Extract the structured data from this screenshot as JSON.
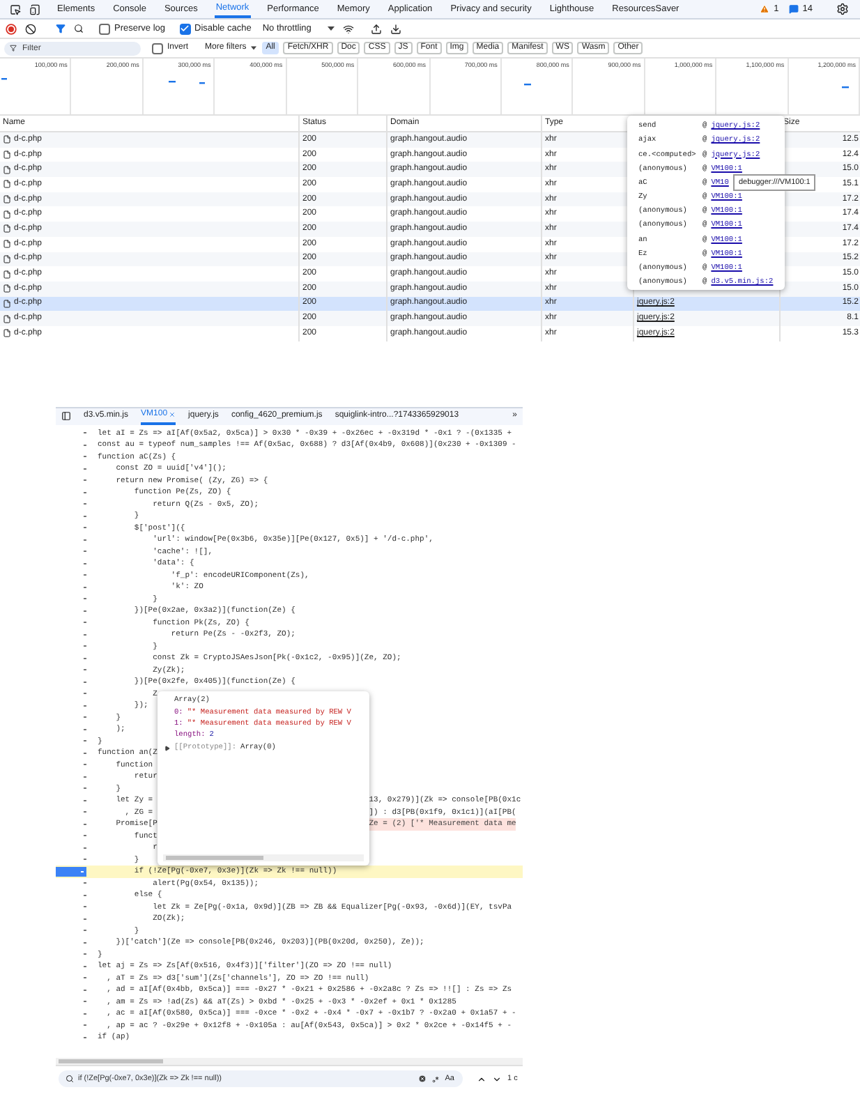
{
  "devtools_tabs": [
    {
      "label": "Elements",
      "selected": false
    },
    {
      "label": "Console",
      "selected": false
    },
    {
      "label": "Sources",
      "selected": false
    },
    {
      "label": "Network",
      "selected": true
    },
    {
      "label": "Performance",
      "selected": false
    },
    {
      "label": "Memory",
      "selected": false
    },
    {
      "label": "Application",
      "selected": false
    },
    {
      "label": "Privacy and security",
      "selected": false
    },
    {
      "label": "Lighthouse",
      "selected": false
    },
    {
      "label": "ResourcesSaver",
      "selected": false
    }
  ],
  "warnings_count": "1",
  "messages_count": "14",
  "toolbar": {
    "preserve_log": {
      "label": "Preserve log",
      "checked": false
    },
    "disable_cache": {
      "label": "Disable cache",
      "checked": true
    },
    "throttling": "No throttling"
  },
  "filter_bar": {
    "placeholder": "Filter",
    "invert": {
      "label": "Invert",
      "checked": false
    },
    "more_filters": "More filters",
    "types": [
      {
        "label": "All",
        "selected": true
      },
      {
        "label": "Fetch/XHR",
        "selected": false
      },
      {
        "label": "Doc",
        "selected": false
      },
      {
        "label": "CSS",
        "selected": false
      },
      {
        "label": "JS",
        "selected": false
      },
      {
        "label": "Font",
        "selected": false
      },
      {
        "label": "Img",
        "selected": false
      },
      {
        "label": "Media",
        "selected": false
      },
      {
        "label": "Manifest",
        "selected": false
      },
      {
        "label": "WS",
        "selected": false
      },
      {
        "label": "Wasm",
        "selected": false
      },
      {
        "label": "Other",
        "selected": false
      }
    ]
  },
  "timeline": {
    "ticks": [
      "100,000 ms",
      "200,000 ms",
      "300,000 ms",
      "400,000 ms",
      "500,000 ms",
      "600,000 ms",
      "700,000 ms",
      "800,000 ms",
      "900,000 ms",
      "1,000,000 ms",
      "1,100,000 ms",
      "1,200,000 ms"
    ]
  },
  "network_table": {
    "columns": [
      "Name",
      "Status",
      "Domain",
      "Type",
      "Size"
    ],
    "rows": [
      {
        "name": "d-c.php",
        "status": "200",
        "domain": "graph.hangout.audio",
        "type": "xhr",
        "size": "12.5",
        "selected": false
      },
      {
        "name": "d-c.php",
        "status": "200",
        "domain": "graph.hangout.audio",
        "type": "xhr",
        "size": "12.4",
        "selected": false
      },
      {
        "name": "d-c.php",
        "status": "200",
        "domain": "graph.hangout.audio",
        "type": "xhr",
        "size": "15.0",
        "selected": false
      },
      {
        "name": "d-c.php",
        "status": "200",
        "domain": "graph.hangout.audio",
        "type": "xhr",
        "size": "15.1",
        "selected": false
      },
      {
        "name": "d-c.php",
        "status": "200",
        "domain": "graph.hangout.audio",
        "type": "xhr",
        "size": "17.2",
        "selected": false
      },
      {
        "name": "d-c.php",
        "status": "200",
        "domain": "graph.hangout.audio",
        "type": "xhr",
        "size": "17.4",
        "selected": false
      },
      {
        "name": "d-c.php",
        "status": "200",
        "domain": "graph.hangout.audio",
        "type": "xhr",
        "size": "17.4",
        "selected": false
      },
      {
        "name": "d-c.php",
        "status": "200",
        "domain": "graph.hangout.audio",
        "type": "xhr",
        "size": "17.2",
        "selected": false
      },
      {
        "name": "d-c.php",
        "status": "200",
        "domain": "graph.hangout.audio",
        "type": "xhr",
        "size": "15.2",
        "selected": false
      },
      {
        "name": "d-c.php",
        "status": "200",
        "domain": "graph.hangout.audio",
        "type": "xhr",
        "size": "15.0",
        "selected": false
      },
      {
        "name": "d-c.php",
        "status": "200",
        "domain": "graph.hangout.audio",
        "type": "xhr",
        "size": "15.0",
        "selected": false
      },
      {
        "name": "d-c.php",
        "status": "200",
        "domain": "graph.hangout.audio",
        "type": "xhr",
        "initiator": "jquery.js:2",
        "size": "15.2",
        "selected": true
      },
      {
        "name": "d-c.php",
        "status": "200",
        "domain": "graph.hangout.audio",
        "type": "xhr",
        "initiator": "jquery.js:2",
        "size": "8.1",
        "selected": false
      },
      {
        "name": "d-c.php",
        "status": "200",
        "domain": "graph.hangout.audio",
        "type": "xhr",
        "initiator": "jquery.js:2",
        "size": "15.3",
        "selected": false
      }
    ]
  },
  "call_stack_popover": {
    "frames": [
      {
        "function": "send",
        "at": "@",
        "location": "jquery.js:2"
      },
      {
        "function": "ajax",
        "at": "@",
        "location": "jquery.js:2"
      },
      {
        "function": "ce.<computed>",
        "at": "@",
        "location": "jquery.js:2"
      },
      {
        "function": "(anonymous)",
        "at": "@",
        "location": "VM100:1"
      },
      {
        "function": "aC",
        "at": "@",
        "location": "VM10"
      },
      {
        "function": "Zy",
        "at": "@",
        "location": "VM100:1"
      },
      {
        "function": "(anonymous)",
        "at": "@",
        "location": "VM100:1"
      },
      {
        "function": "(anonymous)",
        "at": "@",
        "location": "VM100:1"
      },
      {
        "function": "an",
        "at": "@",
        "location": "VM100:1"
      },
      {
        "function": "Ez",
        "at": "@",
        "location": "VM100:1"
      },
      {
        "function": "(anonymous)",
        "at": "@",
        "location": "VM100:1"
      },
      {
        "function": "(anonymous)",
        "at": "@",
        "location": "d3.v5.min.js:2"
      }
    ]
  },
  "link_tooltip": "debugger:///VM100:1",
  "sources": {
    "tabs": [
      {
        "label": "d3.v5.min.js",
        "selected": false
      },
      {
        "label": "VM100",
        "selected": true
      },
      {
        "label": "jquery.js",
        "selected": false
      },
      {
        "label": "config_4620_premium.js",
        "selected": false
      },
      {
        "label": "squiglink-intro...?1743365929013",
        "selected": false
      }
    ],
    "more": "»",
    "lines": [
      {
        "text": "let aI = Zs => aI[Af(0x5a2, 0x5ca)] > 0x30 * -0x39 + -0x26ec + -0x319d * -0x1 ? -(0x1335 +",
        "kind": "code"
      },
      {
        "text": "const au = typeof num_samples !== Af(0x5ac, 0x688) ? d3[Af(0x4b9, 0x608)](0x230 + -0x1309 -",
        "kind": "code"
      },
      {
        "text": "function aC(Zs) {",
        "kind": "code"
      },
      {
        "text": "    const ZO = uuid['v4']();",
        "kind": "code"
      },
      {
        "text": "    return new Promise( (Zy, ZG) => {",
        "kind": "code"
      },
      {
        "text": "        function Pe(Zs, ZO) {",
        "kind": "code"
      },
      {
        "text": "            return Q(Zs - 0x5, ZO);",
        "kind": "code"
      },
      {
        "text": "        }",
        "kind": "code"
      },
      {
        "text": "        $['post']({",
        "kind": "code"
      },
      {
        "text": "            'url': window[Pe(0x3b6, 0x35e)][Pe(0x127, 0x5)] + '/d-c.php',",
        "kind": "code"
      },
      {
        "text": "            'cache': ![],",
        "kind": "code"
      },
      {
        "text": "            'data': {",
        "kind": "code"
      },
      {
        "text": "                'f_p': encodeURIComponent(Zs),",
        "kind": "code"
      },
      {
        "text": "                'k': ZO",
        "kind": "code"
      },
      {
        "text": "            }",
        "kind": "code"
      },
      {
        "text": "        })[Pe(0x2ae, 0x3a2)](function(Ze) {",
        "kind": "code"
      },
      {
        "text": "            function Pk(Zs, ZO) {",
        "kind": "code"
      },
      {
        "text": "                return Pe(Zs - -0x2f3, ZO);",
        "kind": "code"
      },
      {
        "text": "            }",
        "kind": "code"
      },
      {
        "text": "            const Zk = CryptoJSAesJson[Pk(-0x1c2, -0x95)](Ze, ZO);",
        "kind": "code"
      },
      {
        "text": "            Zy(Zk);",
        "kind": "code"
      },
      {
        "text": "        })[Pe(0x2fe, 0x405)](function(Ze) {",
        "kind": "code"
      },
      {
        "text": "            Z",
        "kind": "code"
      },
      {
        "text": "        });",
        "kind": "code"
      },
      {
        "text": "    }",
        "kind": "code"
      },
      {
        "text": "    );",
        "kind": "code"
      },
      {
        "text": "}",
        "kind": "code"
      },
      {
        "text": "function an(Z",
        "kind": "code"
      },
      {
        "text": "    function",
        "kind": "code"
      },
      {
        "text": "        retur",
        "kind": "code"
      },
      {
        "text": "    }",
        "kind": "code"
      },
      {
        "text": "    let Zy =",
        "kind": "code",
        "tail": {
          "text": "13, 0x279)](Zk => console[PB(0x1c",
          "kind": "code"
        }
      },
      {
        "text": "      , ZG =",
        "kind": "code",
        "tail": {
          "text": "]) : d3[PB(0x1f9, 0x1c1)](aI[PB(",
          "kind": "code"
        }
      },
      {
        "text": "    Promise[P",
        "kind": "code",
        "tail": {
          "text": "Ze = (2) ['* Measurement data me",
          "kind": "value"
        }
      },
      {
        "text": "        funct",
        "kind": "code"
      },
      {
        "text": "            r",
        "kind": "code"
      },
      {
        "text": "        }",
        "kind": "code"
      },
      {
        "text": "        if (!Ze[Pg(-0xe7, 0x3e)](Zk => Zk !== null))",
        "kind": "paused"
      },
      {
        "text": "            alert(Pg(0x54, 0x135));",
        "kind": "code"
      },
      {
        "text": "        else {",
        "kind": "code"
      },
      {
        "text": "            let Zk = Ze[Pg(-0x1a, 0x9d)](ZB => ZB && Equalizer[Pg(-0x93, -0x6d)](EY, tsvPa",
        "kind": "code"
      },
      {
        "text": "            ZO(Zk);",
        "kind": "code"
      },
      {
        "text": "        }",
        "kind": "code"
      },
      {
        "text": "    })['catch'](Ze => console[PB(0x246, 0x203)](PB(0x20d, 0x250), Ze));",
        "kind": "code"
      },
      {
        "text": "}",
        "kind": "code"
      },
      {
        "text": "let aj = Zs => Zs[Af(0x516, 0x4f3)]['filter'](ZO => ZO !== null)",
        "kind": "code"
      },
      {
        "text": "  , aT = Zs => d3['sum'](Zs['channels'], ZO => ZO !== null)",
        "kind": "code"
      },
      {
        "text": "  , ad = aI[Af(0x4bb, 0x5ca)] === -0x27 * -0x21 + 0x2586 + -0x2a8c ? Zs => !![] : Zs => Zs",
        "kind": "code"
      },
      {
        "text": "  , am = Zs => !ad(Zs) && aT(Zs) > 0xbd * -0x25 + -0x3 * -0x2ef + 0x1 * 0x1285",
        "kind": "code"
      },
      {
        "text": "  , ac = aI[Af(0x580, 0x5ca)] === -0xce * -0x2 + -0x4 * -0x7 + -0x1b7 ? -0x2a0 + 0x1a57 + -",
        "kind": "code"
      },
      {
        "text": "  , ap = ac ? -0x29e + 0x12f8 + -0x105a : au[Af(0x543, 0x5ca)] > 0x2 * 0x2ce + -0x14f5 + -",
        "kind": "code"
      },
      {
        "text": "if (ap)",
        "kind": "code"
      }
    ],
    "value_popover": {
      "title": "Array(2)",
      "entries": [
        {
          "key": "0:",
          "value": "\"* Measurement data measured by REW V",
          "kind": "string"
        },
        {
          "key": "1:",
          "value": "\"* Measurement data measured by REW V",
          "kind": "string"
        },
        {
          "key": "length:",
          "value": "2",
          "kind": "number"
        },
        {
          "key": "[[Prototype]]:",
          "value": "Array(0)",
          "kind": "prototype"
        }
      ]
    },
    "search": {
      "value": "if (!Ze[Pg(-0xe7, 0x3e)](Zk => Zk !== null))",
      "case_label": "Aa",
      "count": "1 c"
    }
  }
}
